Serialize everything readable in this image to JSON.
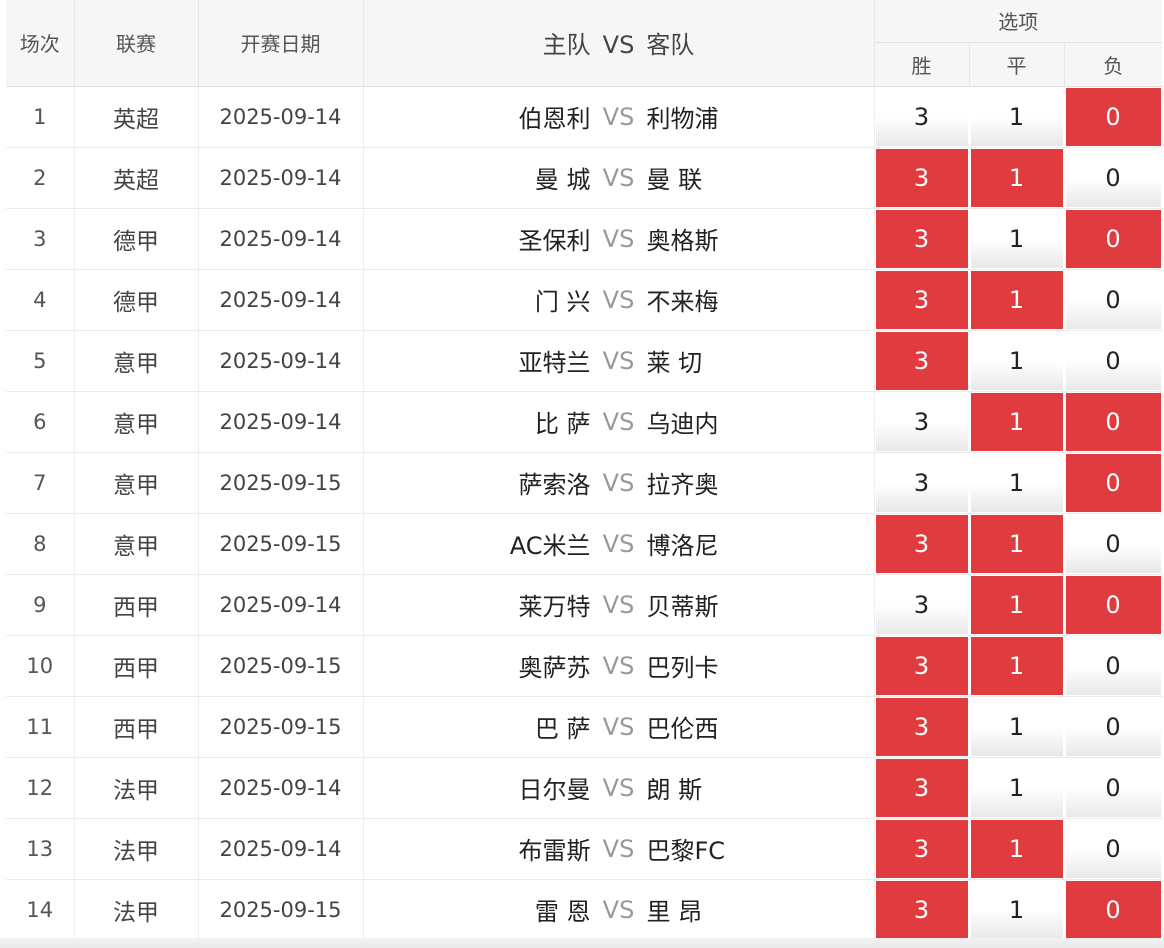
{
  "header": {
    "round": "场次",
    "league": "联赛",
    "date": "开赛日期",
    "home": "主队",
    "vs": "VS",
    "away": "客队",
    "options": "选项",
    "win": "胜",
    "draw": "平",
    "loss": "负"
  },
  "colors": {
    "selected": "#e03b3e",
    "header_bg": "#f6f6f6"
  },
  "rows": [
    {
      "no": "1",
      "league": "英超",
      "date": "2025-09-14",
      "home": "伯恩利",
      "vs": "VS",
      "away": "利物浦",
      "win": "3",
      "draw": "1",
      "loss": "0",
      "sel_win": false,
      "sel_draw": false,
      "sel_loss": true
    },
    {
      "no": "2",
      "league": "英超",
      "date": "2025-09-14",
      "home": "曼 城",
      "vs": "VS",
      "away": "曼 联",
      "win": "3",
      "draw": "1",
      "loss": "0",
      "sel_win": true,
      "sel_draw": true,
      "sel_loss": false
    },
    {
      "no": "3",
      "league": "德甲",
      "date": "2025-09-14",
      "home": "圣保利",
      "vs": "VS",
      "away": "奥格斯",
      "win": "3",
      "draw": "1",
      "loss": "0",
      "sel_win": true,
      "sel_draw": false,
      "sel_loss": true
    },
    {
      "no": "4",
      "league": "德甲",
      "date": "2025-09-14",
      "home": "门 兴",
      "vs": "VS",
      "away": "不来梅",
      "win": "3",
      "draw": "1",
      "loss": "0",
      "sel_win": true,
      "sel_draw": true,
      "sel_loss": false
    },
    {
      "no": "5",
      "league": "意甲",
      "date": "2025-09-14",
      "home": "亚特兰",
      "vs": "VS",
      "away": "莱 切",
      "win": "3",
      "draw": "1",
      "loss": "0",
      "sel_win": true,
      "sel_draw": false,
      "sel_loss": false
    },
    {
      "no": "6",
      "league": "意甲",
      "date": "2025-09-14",
      "home": "比 萨",
      "vs": "VS",
      "away": "乌迪内",
      "win": "3",
      "draw": "1",
      "loss": "0",
      "sel_win": false,
      "sel_draw": true,
      "sel_loss": true
    },
    {
      "no": "7",
      "league": "意甲",
      "date": "2025-09-15",
      "home": "萨索洛",
      "vs": "VS",
      "away": "拉齐奥",
      "win": "3",
      "draw": "1",
      "loss": "0",
      "sel_win": false,
      "sel_draw": false,
      "sel_loss": true
    },
    {
      "no": "8",
      "league": "意甲",
      "date": "2025-09-15",
      "home": "AC米兰",
      "vs": "VS",
      "away": "博洛尼",
      "win": "3",
      "draw": "1",
      "loss": "0",
      "sel_win": true,
      "sel_draw": true,
      "sel_loss": false
    },
    {
      "no": "9",
      "league": "西甲",
      "date": "2025-09-14",
      "home": "莱万特",
      "vs": "VS",
      "away": "贝蒂斯",
      "win": "3",
      "draw": "1",
      "loss": "0",
      "sel_win": false,
      "sel_draw": true,
      "sel_loss": true
    },
    {
      "no": "10",
      "league": "西甲",
      "date": "2025-09-15",
      "home": "奥萨苏",
      "vs": "VS",
      "away": "巴列卡",
      "win": "3",
      "draw": "1",
      "loss": "0",
      "sel_win": true,
      "sel_draw": true,
      "sel_loss": false
    },
    {
      "no": "11",
      "league": "西甲",
      "date": "2025-09-15",
      "home": "巴 萨",
      "vs": "VS",
      "away": "巴伦西",
      "win": "3",
      "draw": "1",
      "loss": "0",
      "sel_win": true,
      "sel_draw": false,
      "sel_loss": false
    },
    {
      "no": "12",
      "league": "法甲",
      "date": "2025-09-14",
      "home": "日尔曼",
      "vs": "VS",
      "away": "朗 斯",
      "win": "3",
      "draw": "1",
      "loss": "0",
      "sel_win": true,
      "sel_draw": false,
      "sel_loss": false
    },
    {
      "no": "13",
      "league": "法甲",
      "date": "2025-09-14",
      "home": "布雷斯",
      "vs": "VS",
      "away": "巴黎FC",
      "win": "3",
      "draw": "1",
      "loss": "0",
      "sel_win": true,
      "sel_draw": true,
      "sel_loss": false
    },
    {
      "no": "14",
      "league": "法甲",
      "date": "2025-09-15",
      "home": "雷 恩",
      "vs": "VS",
      "away": "里 昂",
      "win": "3",
      "draw": "1",
      "loss": "0",
      "sel_win": true,
      "sel_draw": false,
      "sel_loss": true
    }
  ]
}
